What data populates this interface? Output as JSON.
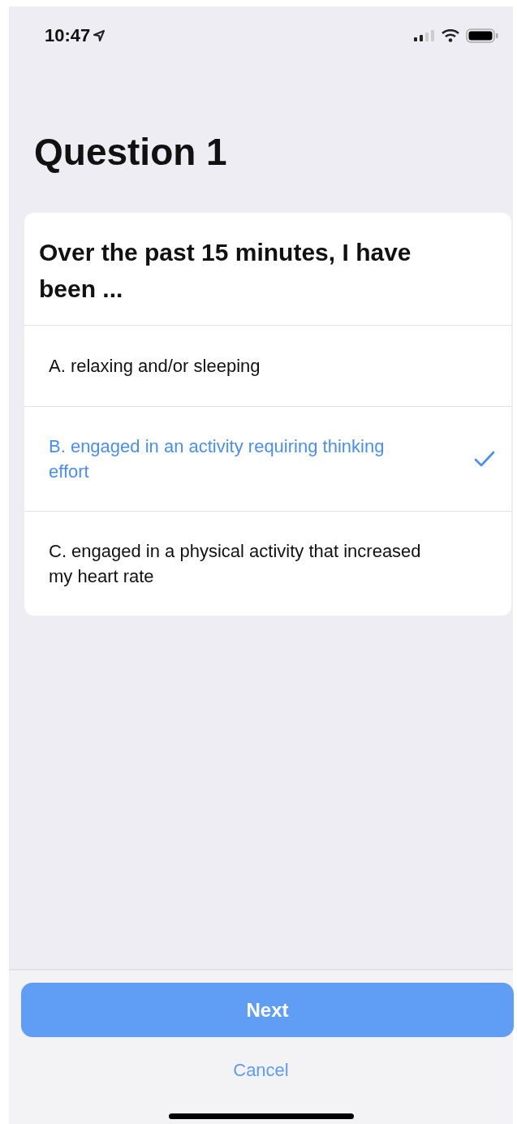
{
  "status_bar": {
    "time": "10:47"
  },
  "title": "Question 1",
  "question": {
    "prompt": "Over the past 15 minutes, I have been ...",
    "options": [
      {
        "label": "A. relaxing and/or sleeping",
        "selected": false
      },
      {
        "label": "B. engaged in an activity requiring thinking effort",
        "selected": true
      },
      {
        "label": "C. engaged in a physical activity that increased my heart rate",
        "selected": false
      }
    ]
  },
  "buttons": {
    "primary": "Next",
    "secondary": "Cancel"
  }
}
